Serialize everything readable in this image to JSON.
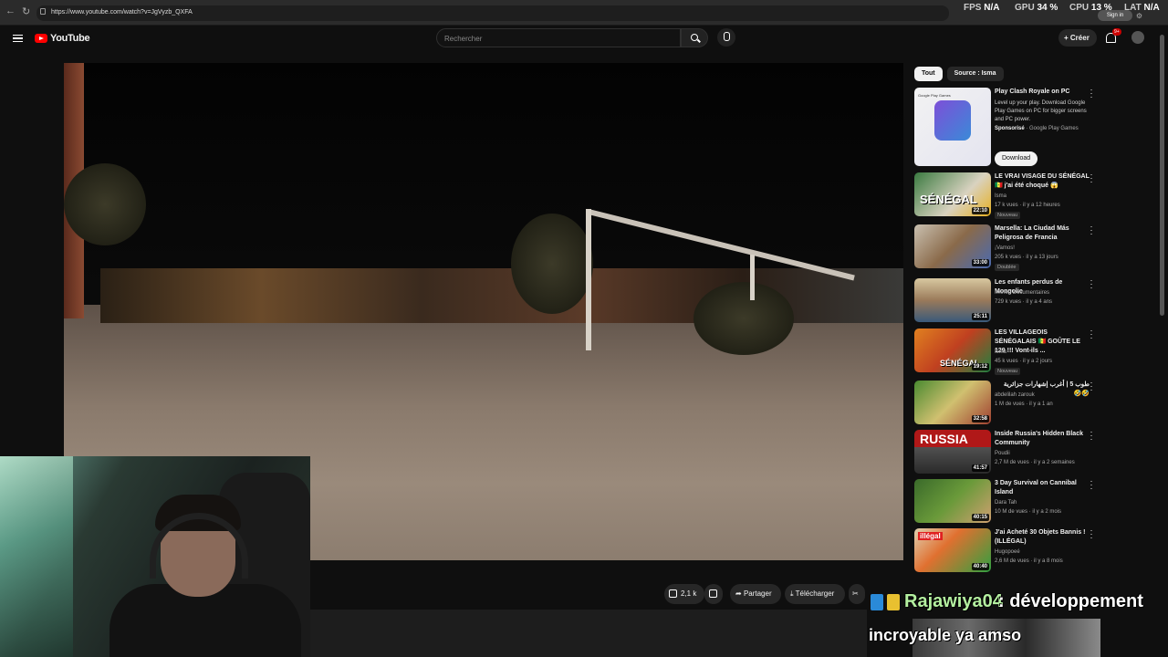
{
  "browser": {
    "url": "https://www.youtube.com/watch?v=JgVyzb_QXFA",
    "hud": {
      "fps_label": "FPS",
      "fps_value": "N/A",
      "gpu_label": "GPU",
      "gpu_value": "34 %",
      "cpu_label": "CPU",
      "cpu_value": "13 %",
      "lat_label": "LAT",
      "lat_value": "N/A"
    },
    "sign_in": "Sign in"
  },
  "header": {
    "brand": "YouTube",
    "search_placeholder": "Rechercher",
    "create_label": "Créer",
    "notif_count": "9+"
  },
  "actions": {
    "likes": "2,1 k",
    "share": "Partager",
    "download": "Télécharger"
  },
  "chips": [
    "Tout",
    "Source : Isma"
  ],
  "sponsored": {
    "title": "Play Clash Royale on PC",
    "desc": "Level up your play. Download Google Play Games on PC for bigger screens and PC power.",
    "sponsor_label": "Sponsorisé",
    "sponsor_name": " · Google Play Games",
    "thumb_label": "Google Play Games",
    "cta": "Download"
  },
  "recommendations": [
    {
      "title": "LE VRAI VISAGE DU SÉNÉGAL 🇸🇳 j'ai été choqué 😱",
      "channel": "Isma",
      "meta": "17 k vues · il y a 12 heures",
      "badge": "Nouveau",
      "duration": "22:10",
      "thumb_text": "SÉNÉGAL"
    },
    {
      "title": "Marsella: La Ciudad Más Peligrosa de Francia",
      "channel": "¡Vamos!",
      "meta": "205 k vues · il y a 13 jours",
      "badge": "Doublée",
      "duration": "33:00",
      "thumb_text": ""
    },
    {
      "title": "Les enfants perdus de Mongolie",
      "channel": "Imineo Documentaires",
      "meta": "729 k vues · il y a 4 ans",
      "badge": "",
      "duration": "25:11",
      "thumb_text": ""
    },
    {
      "title": "LES VILLAGEOIS SÉNÉGALAIS 🇸🇳 GOÛTE LE 129 !!! Vont-ils ...",
      "channel": "Isma",
      "meta": "45 k vues · il y a 2 jours",
      "badge": "Nouveau",
      "duration": "19:12",
      "thumb_text": "SÉNÉGAL"
    },
    {
      "title": "طوب 5 | أغرب إشهارات جزائرية 🤣🤣",
      "channel": "abdelilah zarouk",
      "meta": "1 M de vues · il y a 1 an",
      "badge": "",
      "duration": "32:58",
      "thumb_text": ""
    },
    {
      "title": "Inside Russia's Hidden Black Community",
      "channel": "Poudii",
      "meta": "2,7 M de vues · il y a 2 semaines",
      "badge": "",
      "duration": "41:57",
      "thumb_text": "RUSSIA"
    },
    {
      "title": "3 Day Survival on Cannibal Island",
      "channel": "Dara Tah",
      "meta": "10 M de vues · il y a 2 mois",
      "badge": "",
      "duration": "40:15",
      "thumb_text": ""
    },
    {
      "title": "J'ai Acheté 30 Objets Bannis ! (ILLÉGAL)",
      "channel": "Hugopoeé",
      "meta": "2,6 M de vues · il y a 8 mois",
      "badge": "",
      "duration": "40:40",
      "thumb_text": "illégal"
    }
  ],
  "chat": {
    "username": "Rajawiya04",
    "message_line1": ": développement",
    "message_line2": "incroyable ya amso"
  },
  "colors": {
    "background": "#0f0f0f",
    "brand_red": "#ff0000",
    "chat_name": "#b4f0a0"
  }
}
